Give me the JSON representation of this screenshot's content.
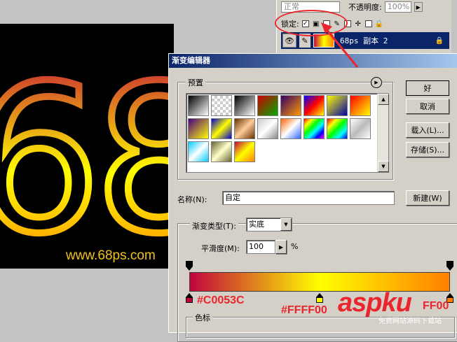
{
  "canvas": {
    "big_number": "68",
    "watermark_url": "www.68ps.com",
    "gradient_colors": [
      "#C0053C",
      "#FFFF00",
      "#FF8000"
    ]
  },
  "layers_panel": {
    "blend_mode": "正常",
    "opacity_label": "不透明度:",
    "opacity_value": "100%",
    "lock_label": "锁定:",
    "layer_name": "68ps 副本 2"
  },
  "gradient_editor": {
    "title": "渐变编辑器",
    "presets_label": "预置",
    "buttons": {
      "ok": "好",
      "cancel": "取消",
      "load": "载入(L)...",
      "save": "存储(S)...",
      "new": "新建(W)"
    },
    "name_label": "名称(N):",
    "name_value": "自定",
    "gradient_type_label": "渐变类型(T):",
    "gradient_type_value": "实底",
    "smoothness_label": "平滑度(M):",
    "smoothness_value": "100",
    "smoothness_unit": "%",
    "stops_label": "色标",
    "presets": [
      "linear-gradient(135deg,#000,#fff)",
      "repeating-conic-gradient(#ccc 0 25%,#fff 0 50%) 0 0/8px 8px",
      "linear-gradient(135deg,#000,#fff)",
      "linear-gradient(135deg,#c00,#0a0)",
      "linear-gradient(135deg,#306,#f90)",
      "linear-gradient(135deg,#00f,#f00,#ff0)",
      "linear-gradient(135deg,#ff0,#00a)",
      "linear-gradient(135deg,#f00,#ff0)",
      "linear-gradient(135deg,#4b0082,#ff0)",
      "linear-gradient(135deg,#00c,#ff0,#00c)",
      "linear-gradient(135deg,#630,#fc9,#630)",
      "linear-gradient(135deg,#ccc,#fff,#888)",
      "linear-gradient(135deg,#f60,#fff,#36f)",
      "linear-gradient(135deg,#f00,#ff0,#0f0,#0ff,#00f,#f0f)",
      "linear-gradient(135deg,#f00,#ff0,#0f0,#0ff,#00f)",
      "linear-gradient(135deg,#fff,#bbb,#fff)",
      "linear-gradient(135deg,#0cf,#fff,#0cf)",
      "linear-gradient(135deg,#663,#ffc,#663)",
      "linear-gradient(135deg,#c0053c,#ffff00,#ff8000)"
    ]
  },
  "annotations": {
    "left_color": "#C0053C",
    "middle_color": "#FFFF00",
    "right_partial": "FF00"
  },
  "branding": {
    "logo": "aspku",
    "logo_sub": "免费网站源码下载站"
  }
}
